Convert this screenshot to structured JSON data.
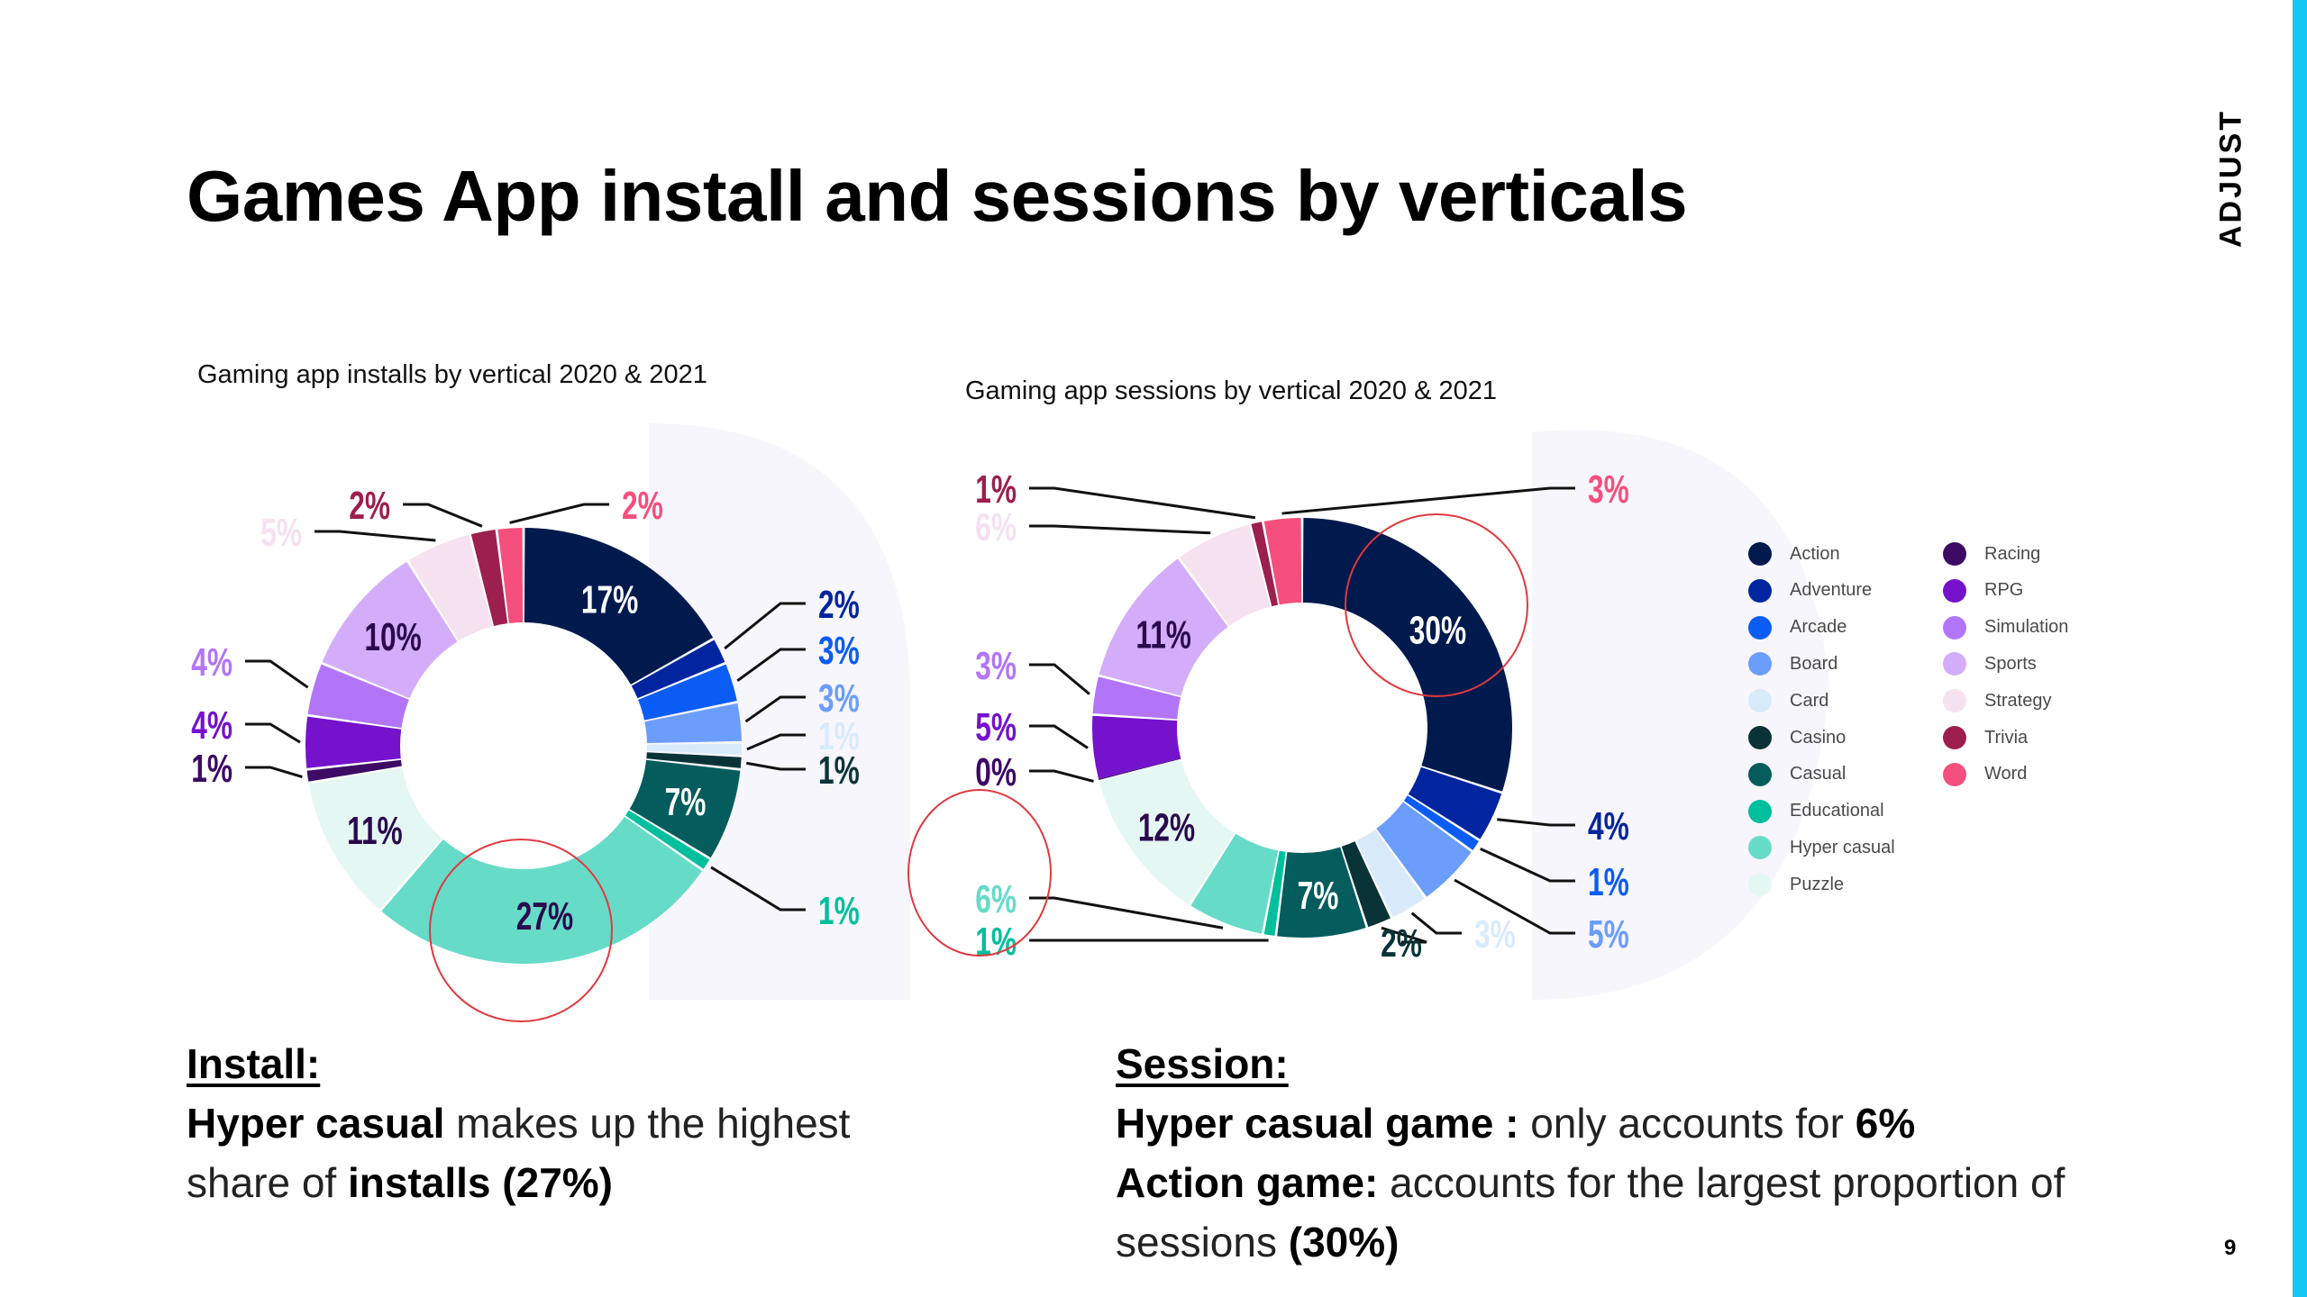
{
  "slide": {
    "title": "Games App install and sessions by verticals",
    "brand": "ADJUST",
    "page_number": "9",
    "accent_color": "#17c6f3",
    "highlight_circle_color": "#e0393e"
  },
  "summaries": {
    "install": {
      "heading": "Install:",
      "line1_bold": "Hyper casual",
      "line1_rest": " makes up the highest",
      "line2_text": "share of ",
      "line2_bold": "installs (27%)"
    },
    "session": {
      "heading": "Session:",
      "line1_bold": "Hyper casual game :",
      "line1_rest": " only accounts for ",
      "line1_bold2": "6%",
      "line2_bold": "Action game:",
      "line2_rest": " accounts for the largest proportion of",
      "line3_text": "sessions ",
      "line3_bold": "(30%)"
    }
  },
  "legend": {
    "items": [
      {
        "label": "Action",
        "color": "#001a4d"
      },
      {
        "label": "Adventure",
        "color": "#00259e"
      },
      {
        "label": "Arcade",
        "color": "#0a5cf5"
      },
      {
        "label": "Board",
        "color": "#6b9dfc"
      },
      {
        "label": "Card",
        "color": "#d9eafb"
      },
      {
        "label": "Casino",
        "color": "#0a3338"
      },
      {
        "label": "Casual",
        "color": "#045c5c"
      },
      {
        "label": "Educational",
        "color": "#00bf9c"
      },
      {
        "label": "Hyper casual",
        "color": "#66dbc8"
      },
      {
        "label": "Puzzle",
        "color": "#e5f7f3"
      },
      {
        "label": "Racing",
        "color": "#3d0a66"
      },
      {
        "label": "RPG",
        "color": "#7512cc"
      },
      {
        "label": "Simulation",
        "color": "#b375f7"
      },
      {
        "label": "Sports",
        "color": "#d4adfa"
      },
      {
        "label": "Strategy",
        "color": "#f5e1f0"
      },
      {
        "label": "Trivia",
        "color": "#9c1f4d"
      },
      {
        "label": "Word",
        "color": "#f54f7d"
      }
    ]
  },
  "chart_data": [
    {
      "type": "pie",
      "variant": "donut",
      "title": "Gaming app installs by vertical 2020 & 2021",
      "categories": [
        "Action",
        "Adventure",
        "Arcade",
        "Board",
        "Card",
        "Casino",
        "Casual",
        "Educational",
        "Hyper casual",
        "Puzzle",
        "Racing",
        "RPG",
        "Simulation",
        "Sports",
        "Strategy",
        "Trivia",
        "Word"
      ],
      "values": [
        17,
        2,
        3,
        3,
        1,
        1,
        7,
        1,
        27,
        11,
        1,
        4,
        4,
        10,
        5,
        2,
        2
      ],
      "labels": [
        "17%",
        "2%",
        "3%",
        "3%",
        "1%",
        "1%",
        "7%",
        "1%",
        "27%",
        "11%",
        "1%",
        "4%",
        "4%",
        "10%",
        "5%",
        "2%",
        "2%"
      ],
      "unit": "%",
      "highlighted": "Hyper casual",
      "legend": "right"
    },
    {
      "type": "pie",
      "variant": "donut",
      "title": "Gaming app sessions by vertical 2020 & 2021",
      "categories": [
        "Action",
        "Adventure",
        "Arcade",
        "Board",
        "Card",
        "Casino",
        "Casual",
        "Educational",
        "Hyper casual",
        "Puzzle",
        "Racing",
        "RPG",
        "Simulation",
        "Sports",
        "Strategy",
        "Trivia",
        "Word"
      ],
      "values": [
        30,
        4,
        1,
        5,
        3,
        2,
        7,
        1,
        6,
        12,
        0,
        5,
        3,
        11,
        6,
        1,
        3
      ],
      "labels": [
        "30%",
        "4%",
        "1%",
        "5%",
        "3%",
        "2%",
        "7%",
        "1%",
        "6%",
        "12%",
        "0%",
        "5%",
        "3%",
        "11%",
        "6%",
        "1%",
        "3%"
      ],
      "unit": "%",
      "highlighted": [
        "Action",
        "Hyper casual"
      ],
      "legend": "right"
    }
  ]
}
